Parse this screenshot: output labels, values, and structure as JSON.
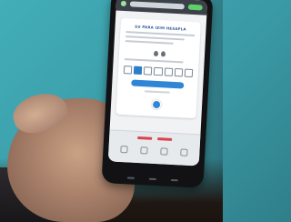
{
  "photo": {
    "description_only": false
  },
  "dialog": {
    "title": "SU PARA IZIM HESAPLA",
    "code_boxes": [
      {
        "filled": false
      },
      {
        "filled": true
      },
      {
        "filled": false
      },
      {
        "filled": false
      },
      {
        "filled": false
      },
      {
        "filled": false
      },
      {
        "filled": false
      }
    ]
  },
  "colors": {
    "background": "#42aeb8",
    "accent": "#2f86d6",
    "title": "#2f5d9a",
    "tab_red": "#d9434f"
  }
}
